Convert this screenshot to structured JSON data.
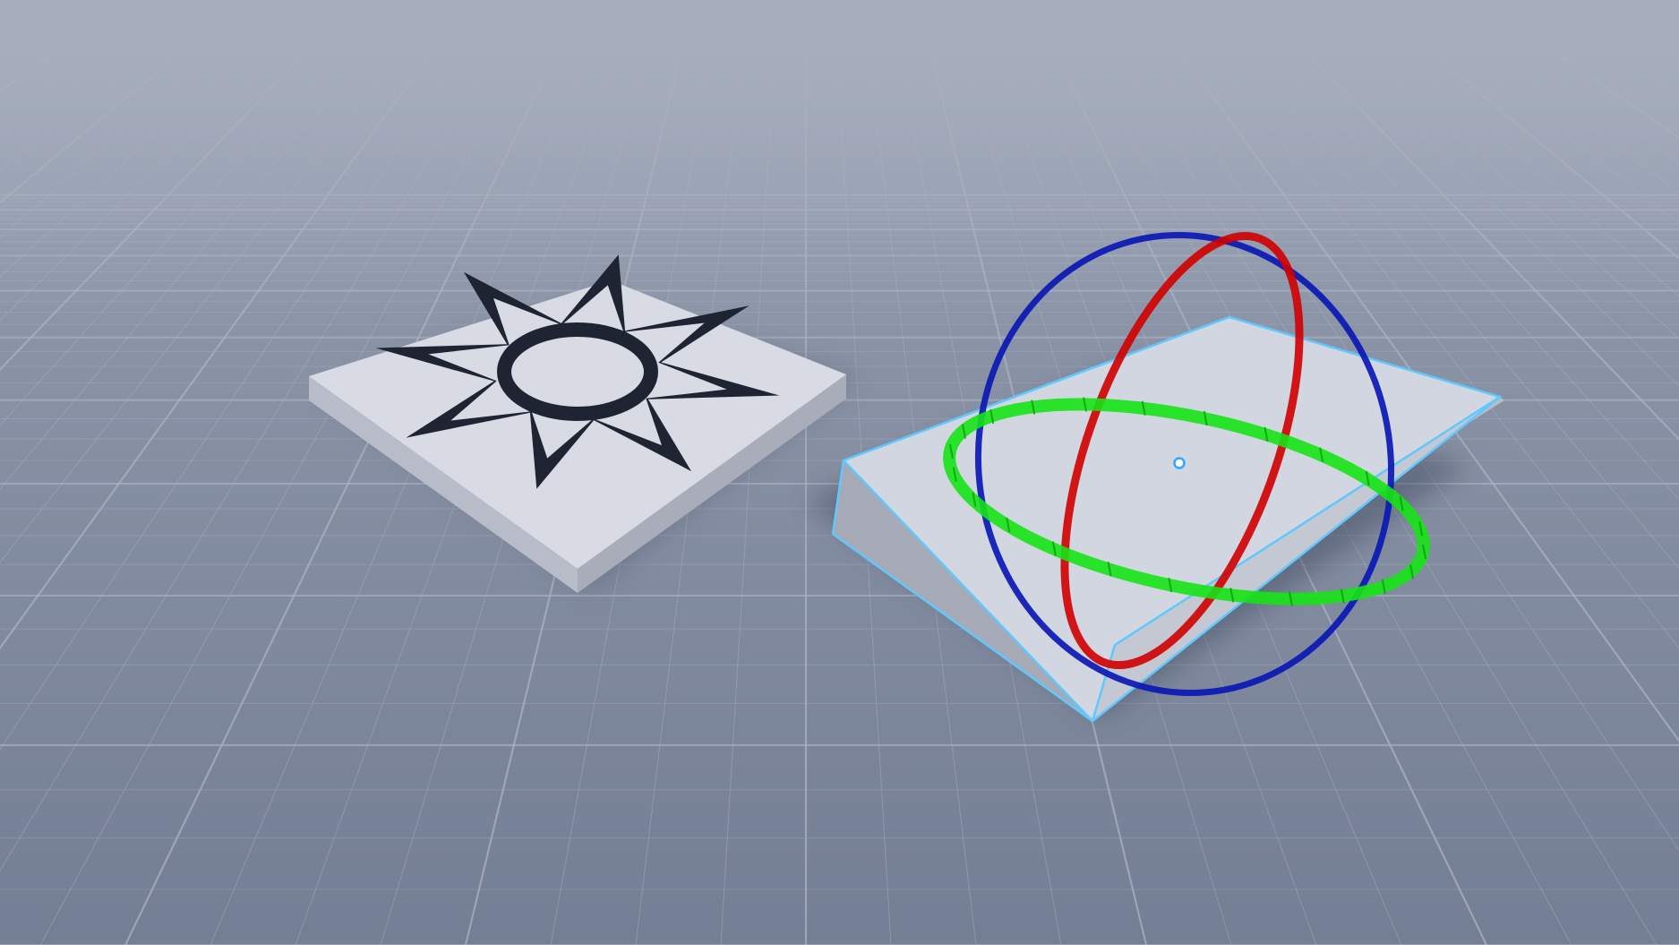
{
  "scene": {
    "viewport_label": "",
    "colors": {
      "sky": "#9aa3b4",
      "ground_near": "#6f7990",
      "ground_far": "#8f98aa",
      "tile_light": "#8c95a8",
      "tile_dark": "#6b7489",
      "grid_line": "#a9b1c0",
      "part_top": "#d6d9e2",
      "part_side": "#b9bdc9",
      "decal": "#1f2433",
      "selection_outline": "#5fc8ff",
      "rotate_x_ring": "#d00000",
      "rotate_y_ring": "#16e316",
      "rotate_z_ring": "#0a18b4",
      "pivot": "#2aa8ff"
    },
    "objects": [
      {
        "name": "decal-plate",
        "decal_icon": "sun-star-icon",
        "selected": false
      },
      {
        "name": "wedge-part",
        "selected": true
      }
    ],
    "tool": {
      "active": "rotate",
      "axes": [
        "x",
        "y",
        "z"
      ]
    }
  }
}
